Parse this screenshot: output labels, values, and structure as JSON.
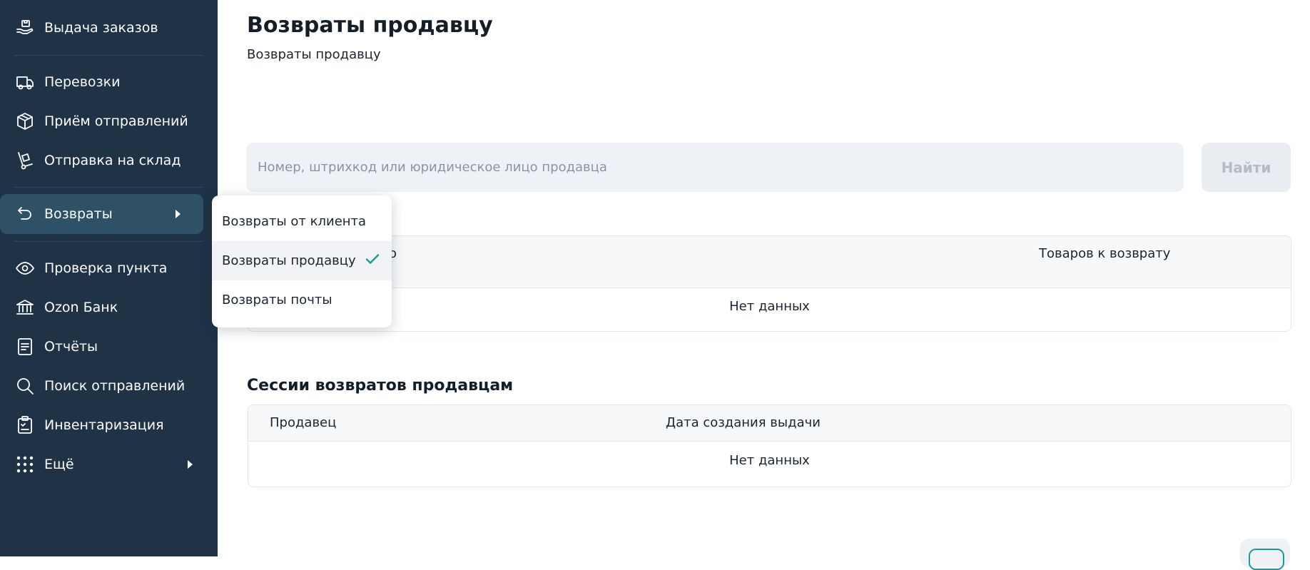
{
  "sidebar": {
    "items": [
      {
        "label": "Выдача заказов",
        "icon": "hand-package-icon"
      },
      {
        "label": "Перевозки",
        "icon": "truck-icon"
      },
      {
        "label": "Приём отправлений",
        "icon": "box-icon"
      },
      {
        "label": "Отправка на склад",
        "icon": "hand-truck-icon"
      },
      {
        "label": "Возвраты",
        "icon": "return-arrow-icon"
      },
      {
        "label": "Проверка пункта",
        "icon": "eye-icon"
      },
      {
        "label": "Ozon Банк",
        "icon": "bank-icon"
      },
      {
        "label": "Отчёты",
        "icon": "document-icon"
      },
      {
        "label": "Поиск отправлений",
        "icon": "search-icon"
      },
      {
        "label": "Инвентаризация",
        "icon": "clipboard-icon"
      },
      {
        "label": "Ещё",
        "icon": "grid-dots-icon"
      }
    ]
  },
  "submenu": {
    "items": [
      {
        "label": "Возвраты от клиента"
      },
      {
        "label": "Возвраты продавцу"
      },
      {
        "label": "Возвраты почты"
      }
    ]
  },
  "page": {
    "title": "Возвраты продавцу",
    "breadcrumb": "Возвраты продавцу"
  },
  "search": {
    "placeholder": "Номер, штрихкод или юридическое лицо продавца",
    "button": "Найти"
  },
  "returns_table": {
    "headers": [
      "о",
      "Товаров к возврату"
    ],
    "empty": "Нет данных"
  },
  "sessions": {
    "title": "Сессии возвратов продавцам",
    "headers": [
      "Продавец",
      "Дата создания выдачи"
    ],
    "empty": "Нет данных"
  },
  "colors": {
    "sidebar_bg": "#1f3246",
    "sidebar_active": "#2e5165",
    "accent": "#1b9c9c"
  }
}
